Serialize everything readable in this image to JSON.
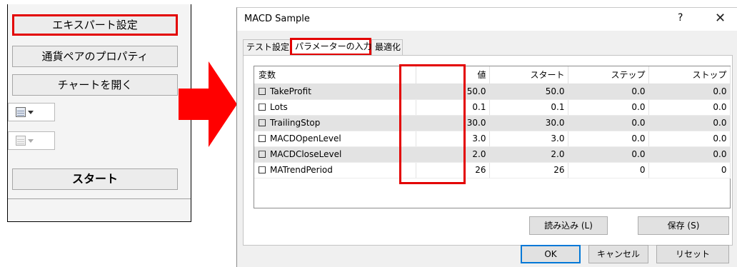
{
  "left_panel": {
    "expert_settings": "エキスパート設定",
    "currency_pair_props": "通貨ペアのプロパティ",
    "open_chart": "チャートを開く",
    "start": "スタート"
  },
  "dialog": {
    "title": "MACD Sample",
    "help": "?",
    "close": "✕",
    "tabs": [
      "テスト設定",
      "パラメーターの入力",
      "最適化"
    ],
    "columns": [
      "変数",
      "値",
      "スタート",
      "ステップ",
      "ストップ"
    ],
    "rows": [
      {
        "name": "TakeProfit",
        "value": "50.0",
        "start": "50.0",
        "step": "0.0",
        "stop": "0.0"
      },
      {
        "name": "Lots",
        "value": "0.1",
        "start": "0.1",
        "step": "0.0",
        "stop": "0.0"
      },
      {
        "name": "TrailingStop",
        "value": "30.0",
        "start": "30.0",
        "step": "0.0",
        "stop": "0.0"
      },
      {
        "name": "MACDOpenLevel",
        "value": "3.0",
        "start": "3.0",
        "step": "0.0",
        "stop": "0.0"
      },
      {
        "name": "MACDCloseLevel",
        "value": "2.0",
        "start": "2.0",
        "step": "0.0",
        "stop": "0.0"
      },
      {
        "name": "MATrendPeriod",
        "value": "26",
        "start": "26",
        "step": "0",
        "stop": "0"
      }
    ],
    "buttons": {
      "load": "読み込み (L)",
      "save": "保存 (S)",
      "ok": "OK",
      "cancel": "キャンセル",
      "reset": "リセット"
    }
  },
  "colors": {
    "highlight": "#e30000",
    "arrow": "#ff0000",
    "default_button_border": "#0078d7"
  }
}
